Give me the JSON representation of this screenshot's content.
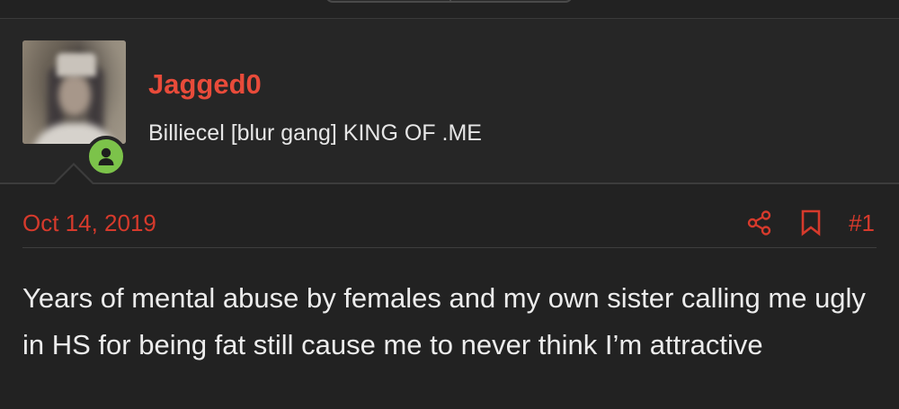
{
  "user": {
    "username": "Jagged0",
    "title": "Billiecel [blur gang] KING OF .ME",
    "status": "online",
    "avatar_icon": "user-icon"
  },
  "post": {
    "date": "Oct 14, 2019",
    "number": "#1",
    "actions": [
      "share-icon",
      "bookmark-icon"
    ],
    "body": "Years of mental abuse by females and my own sister calling me ugly in HS for being fat still cause me to never think I’m attractive"
  },
  "colors": {
    "accent": "#e84b3a",
    "date": "#d63a2c",
    "online": "#7cc34a",
    "background": "#222222"
  }
}
